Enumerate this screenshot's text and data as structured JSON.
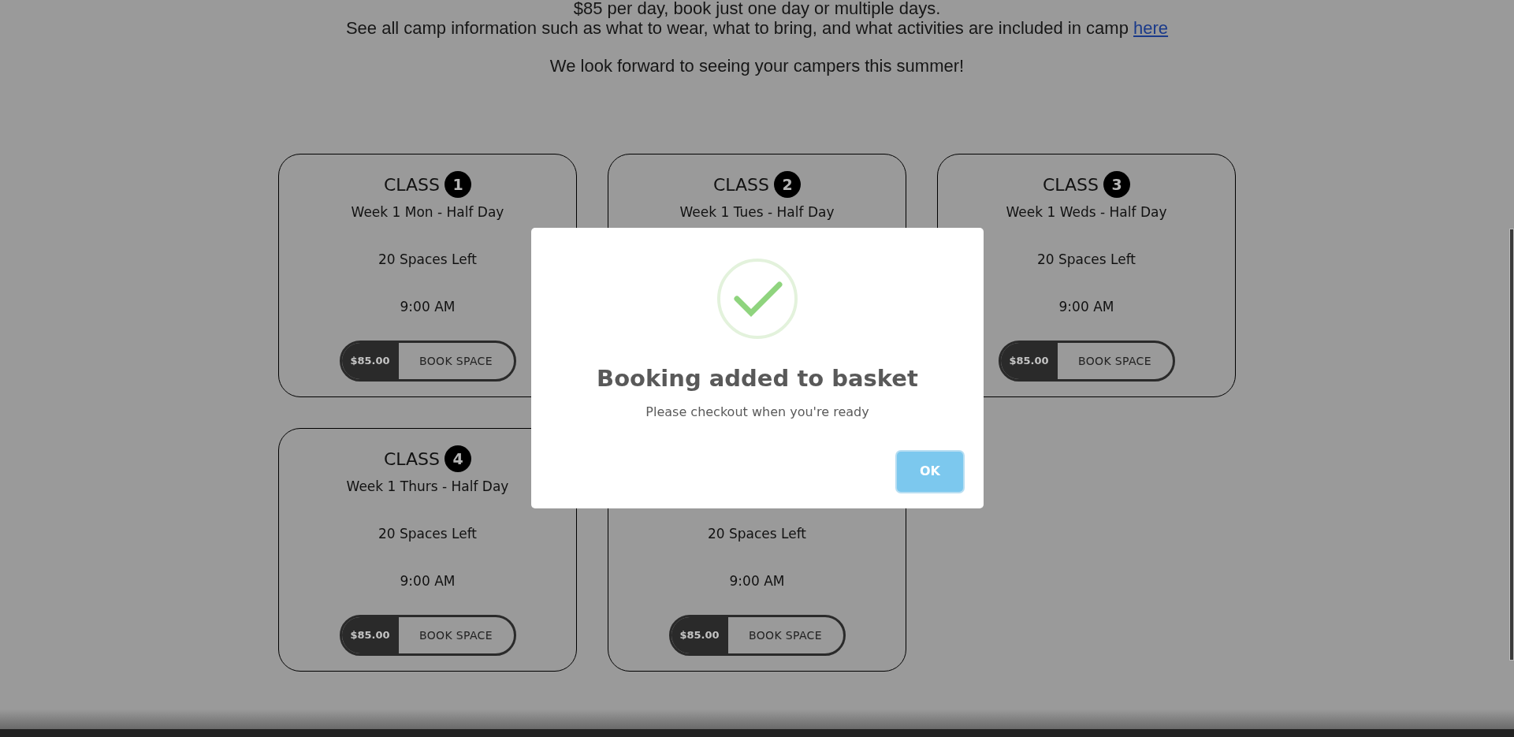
{
  "intro": {
    "lines": [
      {
        "text": "$85 per day, book just one day or multiple days."
      },
      {
        "text": "See all camp information such as what to wear, what to bring, and what activities are included in camp",
        "link": "here"
      },
      {
        "text": "We look forward to seeing your campers this summer!"
      }
    ]
  },
  "cards": [
    {
      "class_label": "CLASS",
      "number": "1",
      "title": "Week 1 Mon - Half Day",
      "spaces": "20 Spaces Left",
      "time": "9:00 AM",
      "price": "$85.00",
      "action": "BOOK SPACE"
    },
    {
      "class_label": "CLASS",
      "number": "2",
      "title": "Week 1 Tues - Half Day"
    },
    {
      "class_label": "CLASS",
      "number": "3",
      "title": "Week 1 Weds - Half Day",
      "spaces": "20 Spaces Left",
      "time": "9:00 AM",
      "price": "$85.00",
      "action": "BOOK SPACE"
    },
    {
      "class_label": "CLASS",
      "number": "4",
      "title": "Week 1 Thurs - Half Day",
      "spaces": "20 Spaces Left",
      "time": "9:00 AM",
      "price": "$85.00",
      "action": "BOOK SPACE"
    },
    {
      "spaces": "20 Spaces Left",
      "time": "9:00 AM",
      "price": "$85.00",
      "action": "BOOK SPACE"
    }
  ],
  "modal": {
    "title": "Booking added to basket",
    "message": "Please checkout when you're ready",
    "button": "OK"
  }
}
